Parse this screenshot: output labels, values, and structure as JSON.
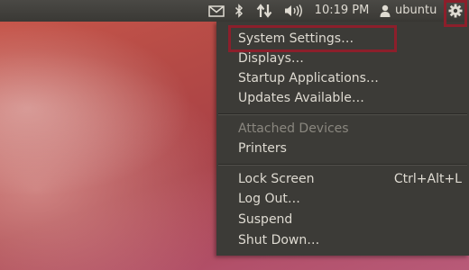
{
  "panel": {
    "time": "10:19 PM",
    "user": "ubuntu",
    "icons": [
      "mail-icon",
      "bluetooth-icon",
      "network-icon",
      "volume-icon",
      "user-icon",
      "gear-icon"
    ]
  },
  "menu": {
    "items": [
      {
        "label": "System Settings…"
      },
      {
        "label": "Displays…"
      },
      {
        "label": "Startup Applications…"
      },
      {
        "label": "Updates Available…"
      },
      {
        "label": "Attached Devices"
      },
      {
        "label": "Printers"
      },
      {
        "label": "Lock Screen",
        "accel": "Ctrl+Alt+L"
      },
      {
        "label": "Log Out…"
      },
      {
        "label": "Suspend"
      },
      {
        "label": "Shut Down…"
      }
    ]
  },
  "colors": {
    "panel": "#3c3b37",
    "menu": "#3c3b37",
    "text": "#dfdbd2",
    "disabled_text": "#8a877f",
    "highlight_box": "#8c1f2b"
  }
}
